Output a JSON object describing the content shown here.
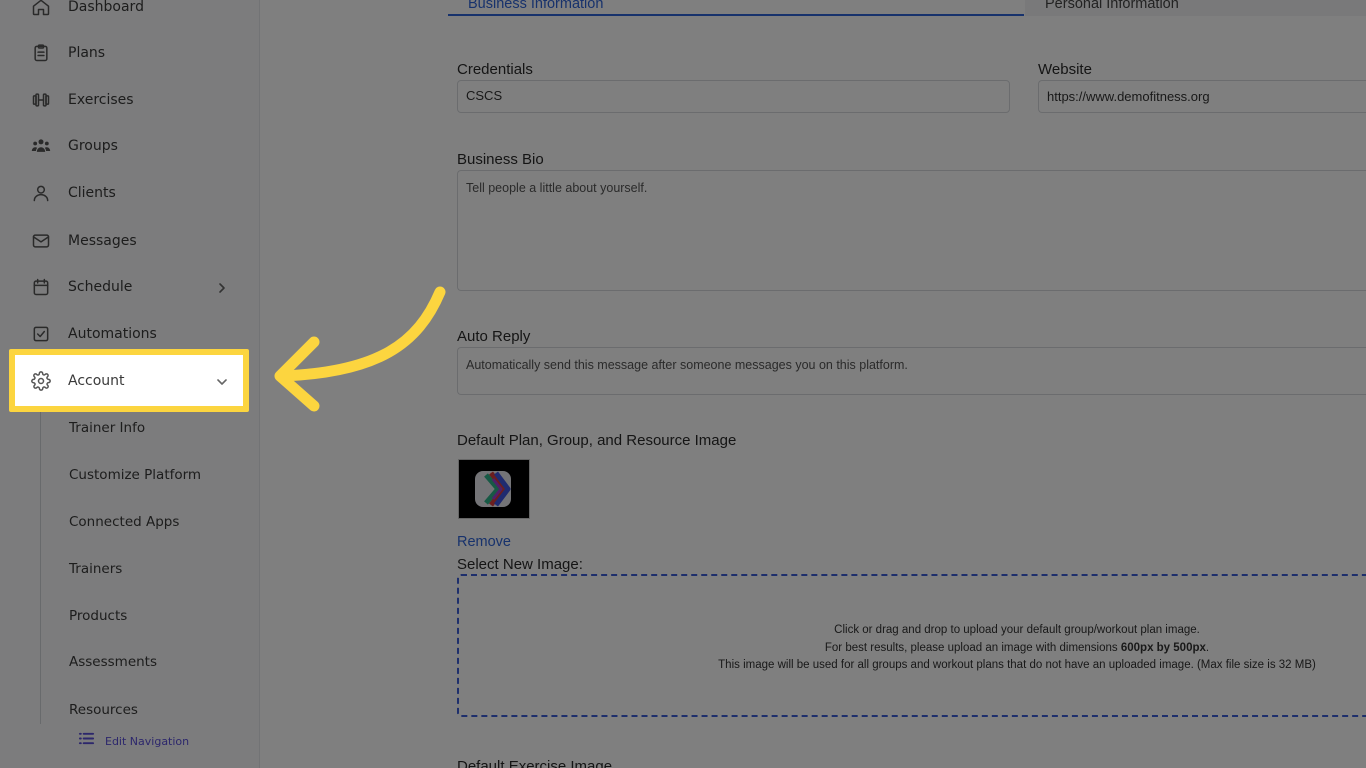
{
  "sidebar": {
    "items": [
      {
        "label": "Dashboard",
        "icon": "home-icon"
      },
      {
        "label": "Plans",
        "icon": "clipboard-icon"
      },
      {
        "label": "Exercises",
        "icon": "dumbbell-icon"
      },
      {
        "label": "Groups",
        "icon": "users-icon"
      },
      {
        "label": "Clients",
        "icon": "user-icon"
      },
      {
        "label": "Messages",
        "icon": "mail-icon"
      },
      {
        "label": "Schedule",
        "icon": "calendar-icon"
      },
      {
        "label": "Automations",
        "icon": "checkbox-icon"
      },
      {
        "label": "Account",
        "icon": "gear-icon"
      }
    ],
    "sub_items": [
      "Trainer Info",
      "Customize Platform",
      "Connected Apps",
      "Trainers",
      "Products",
      "Assessments",
      "Resources"
    ],
    "edit_navigation": "Edit Navigation"
  },
  "tabs": {
    "business": "Business Information",
    "personal": "Personal Information"
  },
  "form": {
    "credentials_label": "Credentials",
    "credentials_value": "CSCS",
    "website_label": "Website",
    "website_value": "https://www.demofitness.org",
    "bio_label": "Business Bio",
    "bio_placeholder": "Tell people a little about yourself.",
    "auto_reply_label": "Auto Reply",
    "auto_reply_placeholder": "Automatically send this message after someone messages you on this platform.",
    "default_image_label": "Default Plan, Group, and Resource Image",
    "remove_label": "Remove",
    "select_new_label": "Select New Image:",
    "dropzone": {
      "line1": "Click or drag and drop to upload your default group/workout plan image.",
      "line2_prefix": "For best results, please upload an image with dimensions ",
      "line2_bold": "600px by 500px",
      "line2_suffix": ".",
      "line3": "This image will be used for all groups and workout plans that do not have an uploaded image. (Max file size is 32 MB)"
    },
    "default_exercise_label": "Default Exercise Image"
  },
  "colors": {
    "highlight": "#fcd53f",
    "link": "#2f64d8",
    "accent": "#5a4fd8"
  }
}
